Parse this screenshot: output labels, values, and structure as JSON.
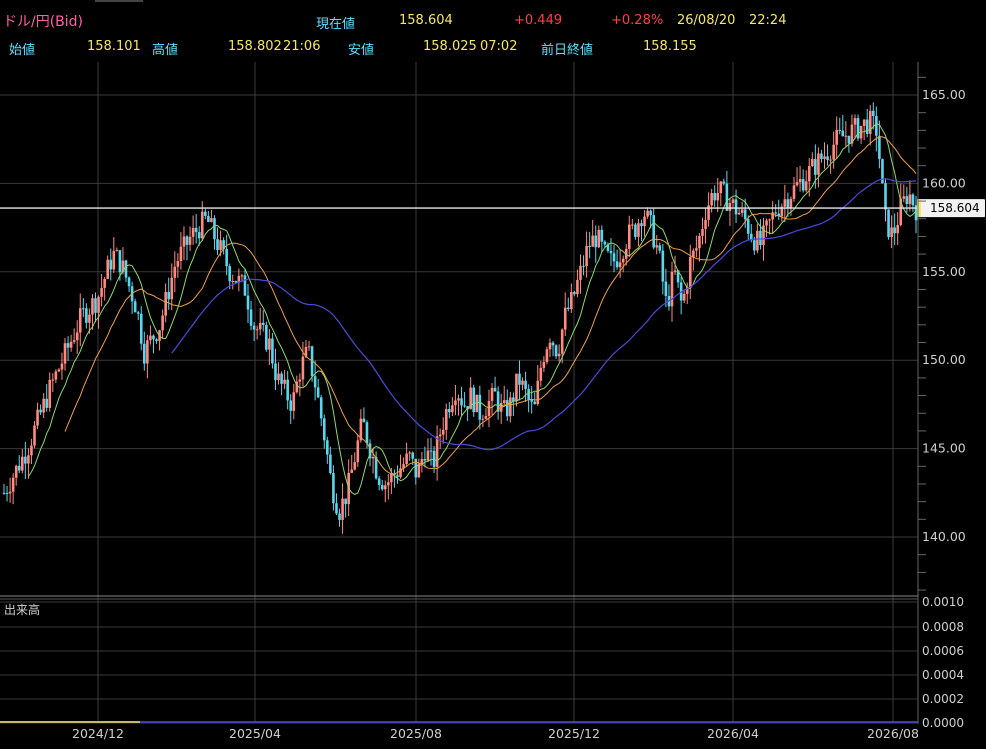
{
  "header": {
    "symbol": "ドル/円(Bid)",
    "current_label": "現在値",
    "current_value": "158.604",
    "change": "+0.449",
    "change_pct": "+0.28%",
    "date": "26/08/20",
    "time": "22:24",
    "open_label": "始値",
    "open_value": "158.101",
    "high_label": "高値",
    "high_value": "158.802",
    "high_time": "21:06",
    "low_label": "安値",
    "low_value": "158.025",
    "low_time": "07:02",
    "prev_close_label": "前日終値",
    "prev_close_value": "158.155"
  },
  "volume_panel": {
    "label": "出来高",
    "ticks": [
      "0.0010",
      "0.0008",
      "0.0006",
      "0.0004",
      "0.0002",
      "0.0000"
    ]
  },
  "colors": {
    "up": "#ff8a80",
    "down": "#5ad7f0",
    "ma_short": "#f0a040",
    "ma_mid": "#8ed86a",
    "ma_long": "#4a4adf",
    "current_line": "#e8e8e8",
    "current_marker": "#f5e663"
  },
  "chart_data": {
    "type": "candlestick",
    "x_tick_labels": [
      "2024/12",
      "2025/04",
      "2025/08",
      "2025/12",
      "2026/04",
      "2026/08"
    ],
    "y_tick_labels": [
      "165.00",
      "160.00",
      "155.00",
      "150.00",
      "145.00",
      "140.00"
    ],
    "ylim": [
      137.0,
      167.0
    ],
    "current_price_label": "158.604",
    "current_price": 158.604,
    "price_path": [
      {
        "t": 0,
        "v": 142.5
      },
      {
        "t": 3,
        "v": 145.0
      },
      {
        "t": 6,
        "v": 148.5
      },
      {
        "t": 8,
        "v": 150.5
      },
      {
        "t": 10,
        "v": 152.5
      },
      {
        "t": 12,
        "v": 153.5
      },
      {
        "t": 14,
        "v": 156.0
      },
      {
        "t": 15,
        "v": 155.5
      },
      {
        "t": 17,
        "v": 153.0
      },
      {
        "t": 18,
        "v": 150.5
      },
      {
        "t": 20,
        "v": 152.0
      },
      {
        "t": 22,
        "v": 155.5
      },
      {
        "t": 24,
        "v": 157.0
      },
      {
        "t": 26,
        "v": 158.0
      },
      {
        "t": 27,
        "v": 157.0
      },
      {
        "t": 29,
        "v": 155.0
      },
      {
        "t": 31,
        "v": 154.0
      },
      {
        "t": 32,
        "v": 152.0
      },
      {
        "t": 34,
        "v": 151.0
      },
      {
        "t": 35,
        "v": 149.0
      },
      {
        "t": 37,
        "v": 147.5
      },
      {
        "t": 38,
        "v": 149.5
      },
      {
        "t": 39,
        "v": 150.5
      },
      {
        "t": 40,
        "v": 148.5
      },
      {
        "t": 41,
        "v": 146.0
      },
      {
        "t": 42,
        "v": 143.0
      },
      {
        "t": 43,
        "v": 141.5
      },
      {
        "t": 44,
        "v": 142.5
      },
      {
        "t": 45,
        "v": 144.5
      },
      {
        "t": 46,
        "v": 146.5
      },
      {
        "t": 47,
        "v": 145.0
      },
      {
        "t": 48,
        "v": 143.5
      },
      {
        "t": 49,
        "v": 143.0
      },
      {
        "t": 51,
        "v": 144.0
      },
      {
        "t": 52,
        "v": 144.5
      },
      {
        "t": 53,
        "v": 143.5
      },
      {
        "t": 54,
        "v": 145.0
      },
      {
        "t": 55,
        "v": 144.0
      },
      {
        "t": 56,
        "v": 146.0
      },
      {
        "t": 57,
        "v": 147.5
      },
      {
        "t": 58,
        "v": 148.5
      },
      {
        "t": 59,
        "v": 147.5
      },
      {
        "t": 60,
        "v": 148.0
      },
      {
        "t": 61,
        "v": 147.0
      },
      {
        "t": 62,
        "v": 147.5
      },
      {
        "t": 63,
        "v": 148.0
      },
      {
        "t": 64,
        "v": 147.0
      },
      {
        "t": 65,
        "v": 147.5
      },
      {
        "t": 66,
        "v": 149.0
      },
      {
        "t": 67,
        "v": 148.0
      },
      {
        "t": 68,
        "v": 147.0
      },
      {
        "t": 69,
        "v": 150.0
      },
      {
        "t": 70,
        "v": 151.5
      },
      {
        "t": 71,
        "v": 150.5
      },
      {
        "t": 72,
        "v": 152.5
      },
      {
        "t": 73,
        "v": 153.5
      },
      {
        "t": 74,
        "v": 155.0
      },
      {
        "t": 75,
        "v": 156.5
      },
      {
        "t": 76,
        "v": 157.0
      },
      {
        "t": 77,
        "v": 156.0
      },
      {
        "t": 78,
        "v": 155.5
      },
      {
        "t": 79,
        "v": 156.0
      },
      {
        "t": 80,
        "v": 157.0
      },
      {
        "t": 81,
        "v": 157.5
      },
      {
        "t": 82,
        "v": 158.5
      },
      {
        "t": 83,
        "v": 157.5
      },
      {
        "t": 84,
        "v": 156.0
      },
      {
        "t": 85,
        "v": 153.0
      },
      {
        "t": 86,
        "v": 155.0
      },
      {
        "t": 87,
        "v": 153.0
      },
      {
        "t": 88,
        "v": 155.5
      },
      {
        "t": 89,
        "v": 156.5
      },
      {
        "t": 90,
        "v": 158.5
      },
      {
        "t": 91,
        "v": 159.5
      },
      {
        "t": 92,
        "v": 159.5
      },
      {
        "t": 93,
        "v": 159.0
      },
      {
        "t": 94,
        "v": 158.5
      },
      {
        "t": 95,
        "v": 158.0
      },
      {
        "t": 96,
        "v": 157.0
      },
      {
        "t": 97,
        "v": 156.5
      },
      {
        "t": 98,
        "v": 157.5
      },
      {
        "t": 99,
        "v": 158.5
      },
      {
        "t": 100,
        "v": 159.0
      },
      {
        "t": 101,
        "v": 159.5
      },
      {
        "t": 103,
        "v": 160.5
      },
      {
        "t": 105,
        "v": 161.5
      },
      {
        "t": 107,
        "v": 162.5
      },
      {
        "t": 109,
        "v": 163.0
      },
      {
        "t": 111,
        "v": 163.5
      },
      {
        "t": 112,
        "v": 163.0
      },
      {
        "t": 113,
        "v": 158.0
      },
      {
        "t": 114,
        "v": 157.0
      },
      {
        "t": 115,
        "v": 158.5
      },
      {
        "t": 116,
        "v": 159.5
      },
      {
        "t": 117,
        "v": 158.6
      }
    ]
  }
}
